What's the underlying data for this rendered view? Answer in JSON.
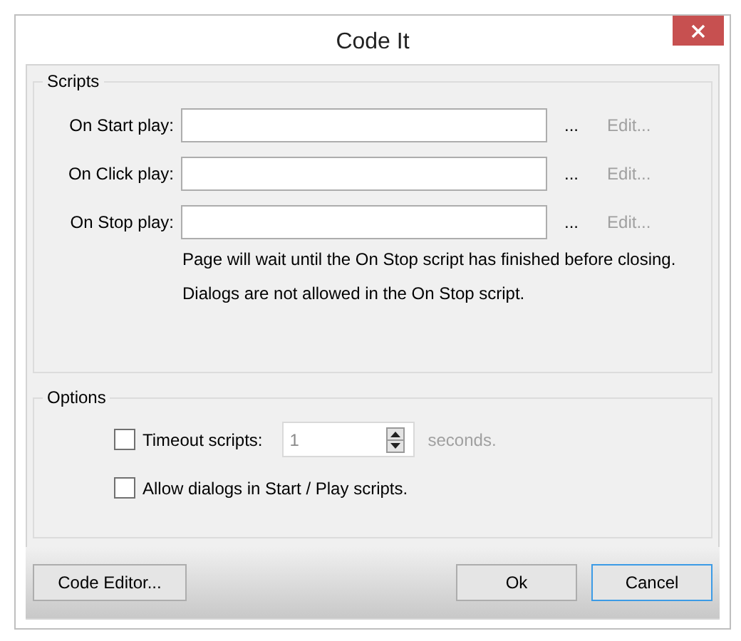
{
  "window": {
    "title": "Code It"
  },
  "scripts": {
    "legend": "Scripts",
    "rows": [
      {
        "label": "On Start play:",
        "value_button": "...",
        "edit": {
          "label": "Edit...",
          "disabled": true
        }
      },
      {
        "label": "On Click play:",
        "value_button": "...",
        "edit": {
          "label": "Edit...",
          "disabled": true
        }
      },
      {
        "label": "On Stop play:",
        "value_button": "...",
        "edit": {
          "label": "Edit...",
          "disabled": true
        }
      }
    ],
    "notes": [
      "Page will wait until the On Stop script has finished before closing.",
      "Dialogs are not allowed in the On Stop script."
    ]
  },
  "options": {
    "legend": "Options",
    "timeout": {
      "label": "Timeout scripts:",
      "checked": false,
      "value": "1",
      "disabled": true,
      "unit": "seconds."
    },
    "allow_dialogs": {
      "label": "Allow dialogs in Start / Play scripts.",
      "checked": false
    }
  },
  "buttons": [
    {
      "label": "Code Editor...",
      "kind": "left",
      "focused": false
    },
    {
      "label": "Ok",
      "kind": "right",
      "focused": false
    },
    {
      "label": "Cancel",
      "kind": "right",
      "focused": true
    }
  ]
}
